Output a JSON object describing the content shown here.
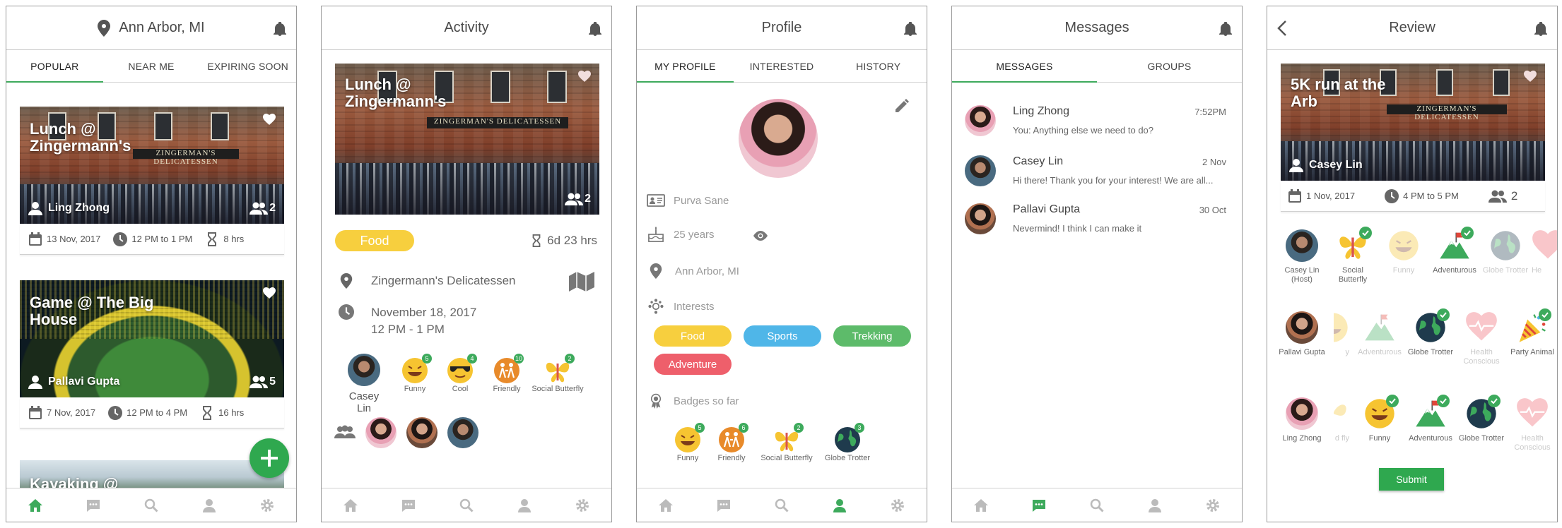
{
  "screen1": {
    "location": "Ann Arbor, MI",
    "tabs": [
      "POPULAR",
      "NEAR ME",
      "EXPIRING SOON"
    ],
    "cards": [
      {
        "title": "Lunch @ Zingermann's",
        "user": "Ling Zhong",
        "count": "2",
        "date": "13 Nov, 2017",
        "time": "12 PM to 1 PM",
        "duration": "8 hrs"
      },
      {
        "title": "Game @ The Big House",
        "user": "Pallavi Gupta",
        "count": "5",
        "date": "7 Nov, 2017",
        "time": "12 PM to 4 PM",
        "duration": "16 hrs"
      },
      {
        "title": "Kayaking @"
      }
    ]
  },
  "screen2": {
    "title": "Activity",
    "photo_title": "Lunch @ Zingermann's",
    "count": "2",
    "category": "Food",
    "expires": "6d 23 hrs",
    "place": "Zingermann's Delicatessen",
    "date": "November 18, 2017",
    "time": "12 PM - 1 PM",
    "host": "Casey Lin",
    "badges": [
      {
        "label": "Funny",
        "count": "5"
      },
      {
        "label": "Cool",
        "count": "4"
      },
      {
        "label": "Friendly",
        "count": "10"
      },
      {
        "label": "Social Butterfly",
        "count": "2"
      }
    ]
  },
  "screen3": {
    "title": "Profile",
    "tabs": [
      "MY PROFILE",
      "INTERESTED",
      "HISTORY"
    ],
    "name": "Purva Sane",
    "age": "25 years",
    "location": "Ann Arbor, MI",
    "interests_label": "Interests",
    "interests": [
      {
        "label": "Food",
        "color": "#f7cf3e"
      },
      {
        "label": "Sports",
        "color": "#4fb6e8"
      },
      {
        "label": "Trekking",
        "color": "#5dbb6a"
      },
      {
        "label": "Adventure",
        "color": "#ee5f6b"
      }
    ],
    "badges_label": "Badges so far",
    "badges": [
      {
        "label": "Funny",
        "count": "5"
      },
      {
        "label": "Friendly",
        "count": "6"
      },
      {
        "label": "Social Butterfly",
        "count": "2"
      },
      {
        "label": "Globe Trotter",
        "count": "3"
      }
    ]
  },
  "screen4": {
    "title": "Messages",
    "tabs": [
      "MESSAGES",
      "GROUPS"
    ],
    "messages": [
      {
        "name": "Ling Zhong",
        "time": "7:52PM",
        "text": "You: Anything else we need to do?"
      },
      {
        "name": "Casey Lin",
        "time": "2 Nov",
        "text": "Hi there! Thank you for your interest! We are all..."
      },
      {
        "name": "Pallavi Gupta",
        "time": "30 Oct",
        "text": "Nevermind! I think I can make it"
      }
    ]
  },
  "screen5": {
    "title": "Review",
    "photo_title": "5K run at the Arb",
    "user": "Casey Lin",
    "date": "1 Nov, 2017",
    "time": "4 PM to 5 PM",
    "count": "2",
    "rows": [
      [
        "Casey Lin (Host)",
        "Social Butterfly",
        "Funny",
        "Adventurous",
        "Globe Trotter",
        "He"
      ],
      [
        "Pallavi Gupta",
        "y",
        "Adventurous",
        "Globe Trotter",
        "Health Conscious",
        "Party Animal"
      ],
      [
        "Ling Zhong",
        "d fly",
        "Funny",
        "Adventurous",
        "Globe Trotter",
        "Health Conscious"
      ]
    ],
    "submit": "Submit"
  },
  "colors": {
    "accent": "#3daa5c",
    "fab": "#2fa84f"
  },
  "icons": [
    "location-pin-icon",
    "bell-icon",
    "heart-icon",
    "calendar-icon",
    "clock-icon",
    "hourglass-icon",
    "people-icon",
    "home-icon",
    "chat-icon",
    "search-icon",
    "user-icon",
    "gear-icon",
    "pencil-icon",
    "map-icon",
    "back-arrow-icon",
    "plus-icon"
  ]
}
